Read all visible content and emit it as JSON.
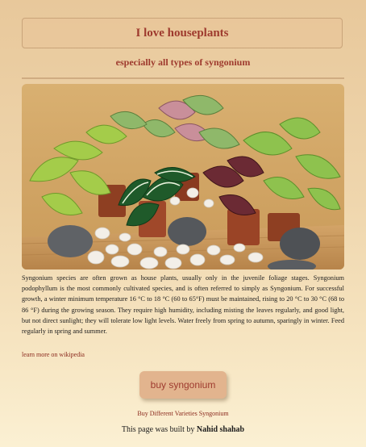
{
  "header": {
    "title": "I love houseplants",
    "subtitle": "especially all types of syngonium"
  },
  "hero_image": {
    "subject": "potted syngonium houseplants with white pebbles and grey stones"
  },
  "description": "Syngonium species are often grown as house plants, usually only in the juvenile foliage stages. Syngonium podophyllum is the most commonly cultivated species, and is often referred to simply as Syngonium. For successful growth, a winter minimum temperature 16 °C to 18 °C (60 to 65°F) must be maintained, rising to 20 °C to 30 °C (68 to 86 °F) during the growing season. They require high humidity, including misting the leaves regularly, and good light, but not direct sunlight; they will tolerate low light levels. Water freely from spring to autumn, sparingly in winter. Feed regularly in spring and summer.",
  "links": {
    "wikipedia": "learn more on wikipedia",
    "varieties": "Buy Different Varieties Syngonium"
  },
  "buy_button": {
    "label": "buy syngonium"
  },
  "footer": {
    "prefix": "This page was built by",
    "author": "Nahid shahab"
  },
  "colors": {
    "accent": "#9e3a2e",
    "button_bg": "#e2b48e",
    "page_bg_top": "#e8c89b",
    "page_bg_bottom": "#fbf0d3"
  }
}
